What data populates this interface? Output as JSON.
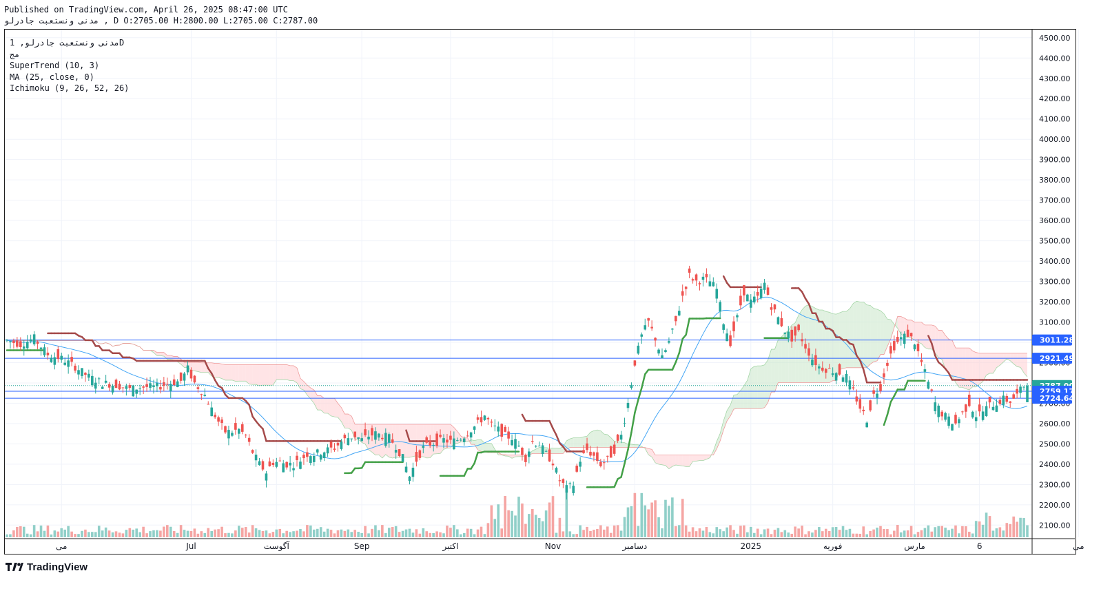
{
  "header": {
    "published": "Published on TradingView.com, April 26, 2025 08:47:00 UTC",
    "symbol_line": "مدنی ونستعبت جادرلو , D",
    "ohlc": [
      "O:2705.00",
      "H:2800.00",
      "L:2705.00",
      "C:2787.00"
    ]
  },
  "legend": {
    "symbol": "مدنی ونستعبت جادرلو, 1D",
    "sub": "مج",
    "indicators": [
      "SuperTrend (10, 3)",
      "MA (25, close, 0)",
      "Ichimoku (9, 26, 52, 26)"
    ]
  },
  "brand": {
    "name": "TradingView"
  },
  "chart_data": {
    "type": "candlestick",
    "y_axis": {
      "side": "right",
      "ylim": [
        2040,
        4540
      ],
      "ticks": [
        4500,
        4400,
        4300,
        4200,
        4100,
        4000,
        3900,
        3800,
        3700,
        3600,
        3500,
        3400,
        3300,
        3200,
        3100,
        3000,
        2900,
        2800,
        2700,
        2600,
        2500,
        2400,
        2300,
        2200,
        2100
      ],
      "tick_labels": [
        "4500.00",
        "4400.00",
        "4300.00",
        "4200.00",
        "4100.00",
        "4000.00",
        "3900.00",
        "3800.00",
        "3700.00",
        "3600.00",
        "3500.00",
        "3400.00",
        "3300.00",
        "3200.00",
        "3100.00",
        "3000.00",
        "2900.00",
        "2800.00",
        "2700.00",
        "2600.00",
        "2500.00",
        "2400.00",
        "2300.00",
        "2200.00",
        "2100.00"
      ]
    },
    "x_axis": {
      "labels": [
        {
          "text": "می",
          "bar": 16
        },
        {
          "text": "Jul",
          "bar": 54
        },
        {
          "text": "آگوست",
          "bar": 79
        },
        {
          "text": "Sep",
          "bar": 104
        },
        {
          "text": "اکتبر",
          "bar": 130
        },
        {
          "text": "Nov",
          "bar": 160
        },
        {
          "text": "دسامبر",
          "bar": 184
        },
        {
          "text": "2025",
          "bar": 218
        },
        {
          "text": "فوریه",
          "bar": 242
        },
        {
          "text": "مارس",
          "bar": 266
        },
        {
          "text": "6",
          "bar": 285
        },
        {
          "text": "می",
          "bar": 314
        }
      ]
    },
    "price_lines": [
      {
        "value": 3011.28,
        "label": "3011.28",
        "color": "#2962ff"
      },
      {
        "value": 2921.49,
        "label": "2921.49",
        "color": "#2962ff"
      },
      {
        "value": 2787.0,
        "label": "2787.00",
        "color": "#26a69a",
        "dotted": true
      },
      {
        "value": 2759.17,
        "label": "2759.17",
        "color": "#2962ff"
      },
      {
        "value": 2724.64,
        "label": "2724.64",
        "color": "#2962ff"
      }
    ],
    "colors": {
      "up": "#26a69a",
      "down": "#ef5350",
      "vol_up": "#90cfc8",
      "vol_down": "#f5a5a3",
      "supertrend_up": "#43a047",
      "supertrend_down": "#a54a4a",
      "ma": "#42a5f5",
      "cloud_bull": "#c8e6c9",
      "cloud_bear": "#ffcdd2",
      "last": "#26a69a",
      "line": "#2962ff"
    },
    "last": {
      "close": 2787.0,
      "open": 2705.0,
      "high": 2800.0,
      "low": 2705.0
    },
    "series_close": [
      [
        0,
        3010
      ],
      [
        4,
        2990
      ],
      [
        8,
        3020
      ],
      [
        12,
        2940
      ],
      [
        16,
        2920
      ],
      [
        20,
        2880
      ],
      [
        24,
        2830
      ],
      [
        28,
        2800
      ],
      [
        32,
        2790
      ],
      [
        36,
        2770
      ],
      [
        40,
        2780
      ],
      [
        44,
        2780
      ],
      [
        48,
        2800
      ],
      [
        51,
        2810
      ],
      [
        53,
        2870
      ],
      [
        55,
        2800
      ],
      [
        58,
        2740
      ],
      [
        60,
        2670
      ],
      [
        62,
        2610
      ],
      [
        64,
        2560
      ],
      [
        66,
        2560
      ],
      [
        68,
        2570
      ],
      [
        70,
        2540
      ],
      [
        72,
        2460
      ],
      [
        74,
        2400
      ],
      [
        76,
        2360
      ],
      [
        78,
        2410
      ],
      [
        80,
        2410
      ],
      [
        82,
        2400
      ],
      [
        84,
        2400
      ],
      [
        86,
        2420
      ],
      [
        88,
        2450
      ],
      [
        90,
        2450
      ],
      [
        92,
        2460
      ],
      [
        94,
        2470
      ],
      [
        96,
        2480
      ],
      [
        98,
        2510
      ],
      [
        100,
        2530
      ],
      [
        102,
        2540
      ],
      [
        104,
        2520
      ],
      [
        106,
        2540
      ],
      [
        108,
        2550
      ],
      [
        110,
        2540
      ],
      [
        112,
        2530
      ],
      [
        114,
        2490
      ],
      [
        116,
        2430
      ],
      [
        118,
        2340
      ],
      [
        120,
        2420
      ],
      [
        122,
        2480
      ],
      [
        124,
        2500
      ],
      [
        126,
        2510
      ],
      [
        128,
        2520
      ],
      [
        130,
        2510
      ],
      [
        132,
        2520
      ],
      [
        134,
        2540
      ],
      [
        136,
        2570
      ],
      [
        138,
        2600
      ],
      [
        140,
        2640
      ],
      [
        142,
        2590
      ],
      [
        144,
        2570
      ],
      [
        146,
        2540
      ],
      [
        148,
        2530
      ],
      [
        150,
        2490
      ],
      [
        152,
        2430
      ],
      [
        154,
        2510
      ],
      [
        156,
        2500
      ],
      [
        158,
        2450
      ],
      [
        160,
        2410
      ],
      [
        162,
        2320
      ],
      [
        164,
        2280
      ],
      [
        166,
        2300
      ],
      [
        168,
        2420
      ],
      [
        170,
        2470
      ],
      [
        172,
        2440
      ],
      [
        174,
        2400
      ],
      [
        176,
        2420
      ],
      [
        178,
        2470
      ],
      [
        180,
        2540
      ],
      [
        182,
        2700
      ],
      [
        184,
        2900
      ],
      [
        186,
        3030
      ],
      [
        188,
        3100
      ],
      [
        190,
        3020
      ],
      [
        192,
        2920
      ],
      [
        194,
        3000
      ],
      [
        196,
        3100
      ],
      [
        198,
        3230
      ],
      [
        200,
        3330
      ],
      [
        202,
        3300
      ],
      [
        204,
        3310
      ],
      [
        206,
        3300
      ],
      [
        208,
        3260
      ],
      [
        210,
        3100
      ],
      [
        212,
        3000
      ],
      [
        214,
        3120
      ],
      [
        216,
        3250
      ],
      [
        218,
        3200
      ],
      [
        220,
        3220
      ],
      [
        222,
        3290
      ],
      [
        224,
        3180
      ],
      [
        226,
        3120
      ],
      [
        228,
        3060
      ],
      [
        230,
        3020
      ],
      [
        232,
        3050
      ],
      [
        234,
        2980
      ],
      [
        236,
        2920
      ],
      [
        238,
        2880
      ],
      [
        240,
        2870
      ],
      [
        242,
        2860
      ],
      [
        244,
        2850
      ],
      [
        246,
        2830
      ],
      [
        248,
        2760
      ],
      [
        250,
        2680
      ],
      [
        252,
        2620
      ],
      [
        254,
        2740
      ],
      [
        256,
        2780
      ],
      [
        258,
        2900
      ],
      [
        260,
        2980
      ],
      [
        262,
        3020
      ],
      [
        264,
        3040
      ],
      [
        266,
        3000
      ],
      [
        268,
        2900
      ],
      [
        270,
        2800
      ],
      [
        272,
        2700
      ],
      [
        274,
        2650
      ],
      [
        276,
        2620
      ],
      [
        278,
        2600
      ],
      [
        280,
        2650
      ],
      [
        282,
        2700
      ],
      [
        284,
        2640
      ],
      [
        286,
        2660
      ],
      [
        288,
        2690
      ],
      [
        290,
        2700
      ],
      [
        292,
        2720
      ],
      [
        294,
        2710
      ],
      [
        296,
        2740
      ],
      [
        298,
        2787
      ]
    ]
  }
}
